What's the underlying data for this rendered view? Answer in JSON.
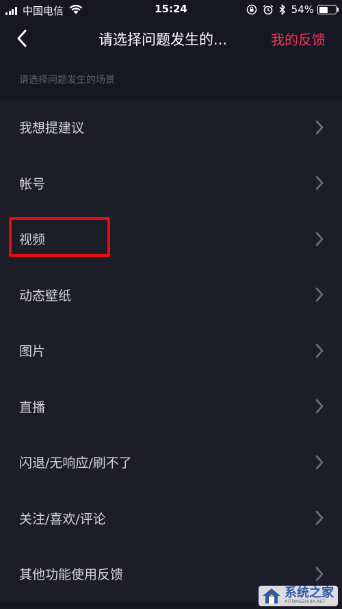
{
  "status_bar": {
    "carrier": "中国电信",
    "time": "15:24",
    "battery_percent": "54%",
    "battery_level": 0.54
  },
  "nav": {
    "title": "请选择问题发生的...",
    "feedback_label": "我的反馈",
    "accent_color": "#f23358"
  },
  "section": {
    "header": "请选择问题发生的场景"
  },
  "items": [
    {
      "label": "我想提建议"
    },
    {
      "label": "帐号"
    },
    {
      "label": "视频"
    },
    {
      "label": "动态壁纸"
    },
    {
      "label": "图片"
    },
    {
      "label": "直播"
    },
    {
      "label": "闪退/无响应/刷不了"
    },
    {
      "label": "关注/喜欢/评论"
    },
    {
      "label": "其他功能使用反馈"
    }
  ],
  "watermark": {
    "name": "系统之家",
    "url": "XITONGZHIJIA.NET"
  }
}
